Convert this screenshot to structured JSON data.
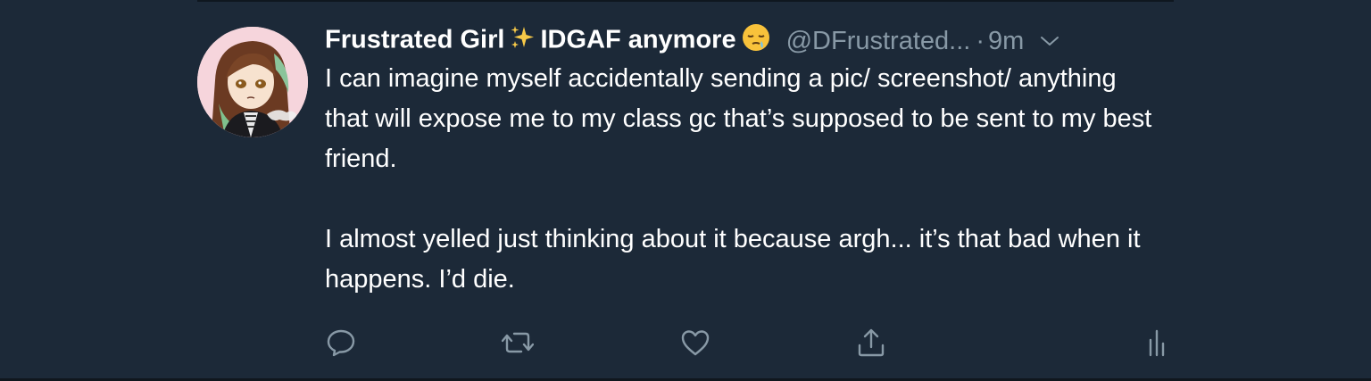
{
  "tweet": {
    "display_name_part1": "Frustrated Girl",
    "name_emoji_1": "sparkles-icon",
    "display_name_part2": "IDGAF anymore",
    "name_emoji_2": "sleepy-face-icon",
    "handle": "@DFrustrated...",
    "separator": "·",
    "time": "9m",
    "paragraphs": [
      "I can imagine myself accidentally sending a pic/ screenshot/ anything that will expose me to my class gc that’s supposed to be sent to my best friend.",
      "I almost yelled just thinking about it because argh... it’s that bad when it happens. I’d die."
    ]
  },
  "actions": [
    "reply-icon",
    "retweet-icon",
    "like-icon",
    "share-icon",
    "analytics-icon"
  ],
  "colors": {
    "background": "#1c2938",
    "text": "#ffffff",
    "secondary_text": "#8899a6",
    "icon": "#8899a6"
  }
}
